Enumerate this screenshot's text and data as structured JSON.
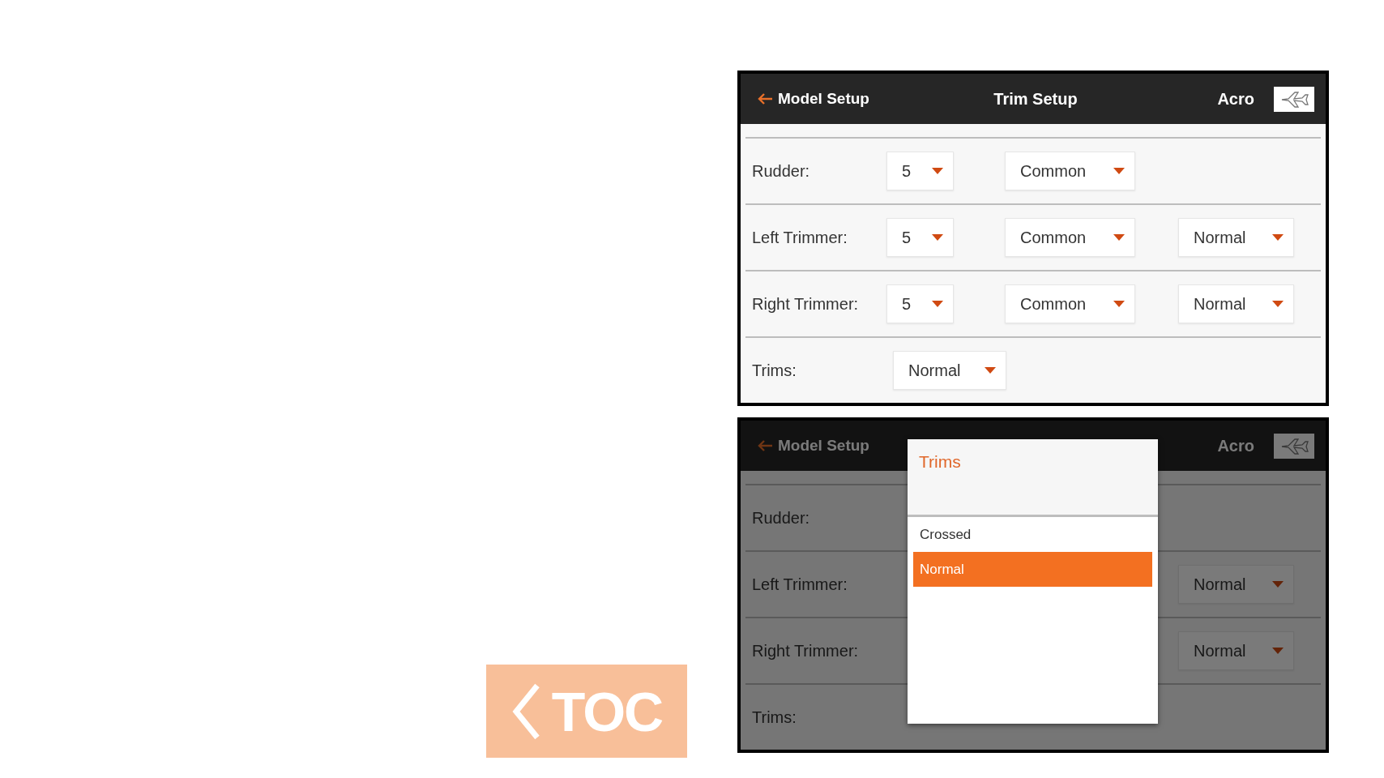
{
  "toc_button": {
    "label": "TOC"
  },
  "screens": [
    {
      "dimmed": false,
      "header": {
        "back_label": "Model Setup",
        "title": "Trim Setup",
        "model_type": "Acro"
      },
      "rows": [
        {
          "label": "Rudder:",
          "dropdowns": [
            {
              "kind": "step",
              "value": "5"
            },
            {
              "kind": "type",
              "value": "Common"
            }
          ]
        },
        {
          "label": "Left Trimmer:",
          "dropdowns": [
            {
              "kind": "step",
              "value": "5"
            },
            {
              "kind": "type",
              "value": "Common"
            },
            {
              "kind": "direction",
              "value": "Normal"
            }
          ]
        },
        {
          "label": "Right Trimmer:",
          "dropdowns": [
            {
              "kind": "step",
              "value": "5"
            },
            {
              "kind": "type",
              "value": "Common"
            },
            {
              "kind": "direction",
              "value": "Normal"
            }
          ]
        },
        {
          "label": "Trims:",
          "dropdowns": [
            {
              "kind": "mode",
              "value": "Normal"
            }
          ]
        }
      ]
    },
    {
      "dimmed": true,
      "header": {
        "back_label": "Model Setup",
        "model_type": "Acro"
      },
      "rows": [
        {
          "label": "Rudder:",
          "dropdowns": []
        },
        {
          "label": "Left Trimmer:",
          "dropdowns": [
            {
              "kind": "direction",
              "value": "Normal"
            }
          ]
        },
        {
          "label": "Right Trimmer:",
          "dropdowns": [
            {
              "kind": "direction",
              "value": "Normal"
            }
          ]
        },
        {
          "label": "Trims:",
          "dropdowns": []
        }
      ],
      "dialog": {
        "title": "Trims",
        "options": [
          {
            "label": "Crossed",
            "selected": false
          },
          {
            "label": "Normal",
            "selected": true
          }
        ]
      }
    }
  ]
}
